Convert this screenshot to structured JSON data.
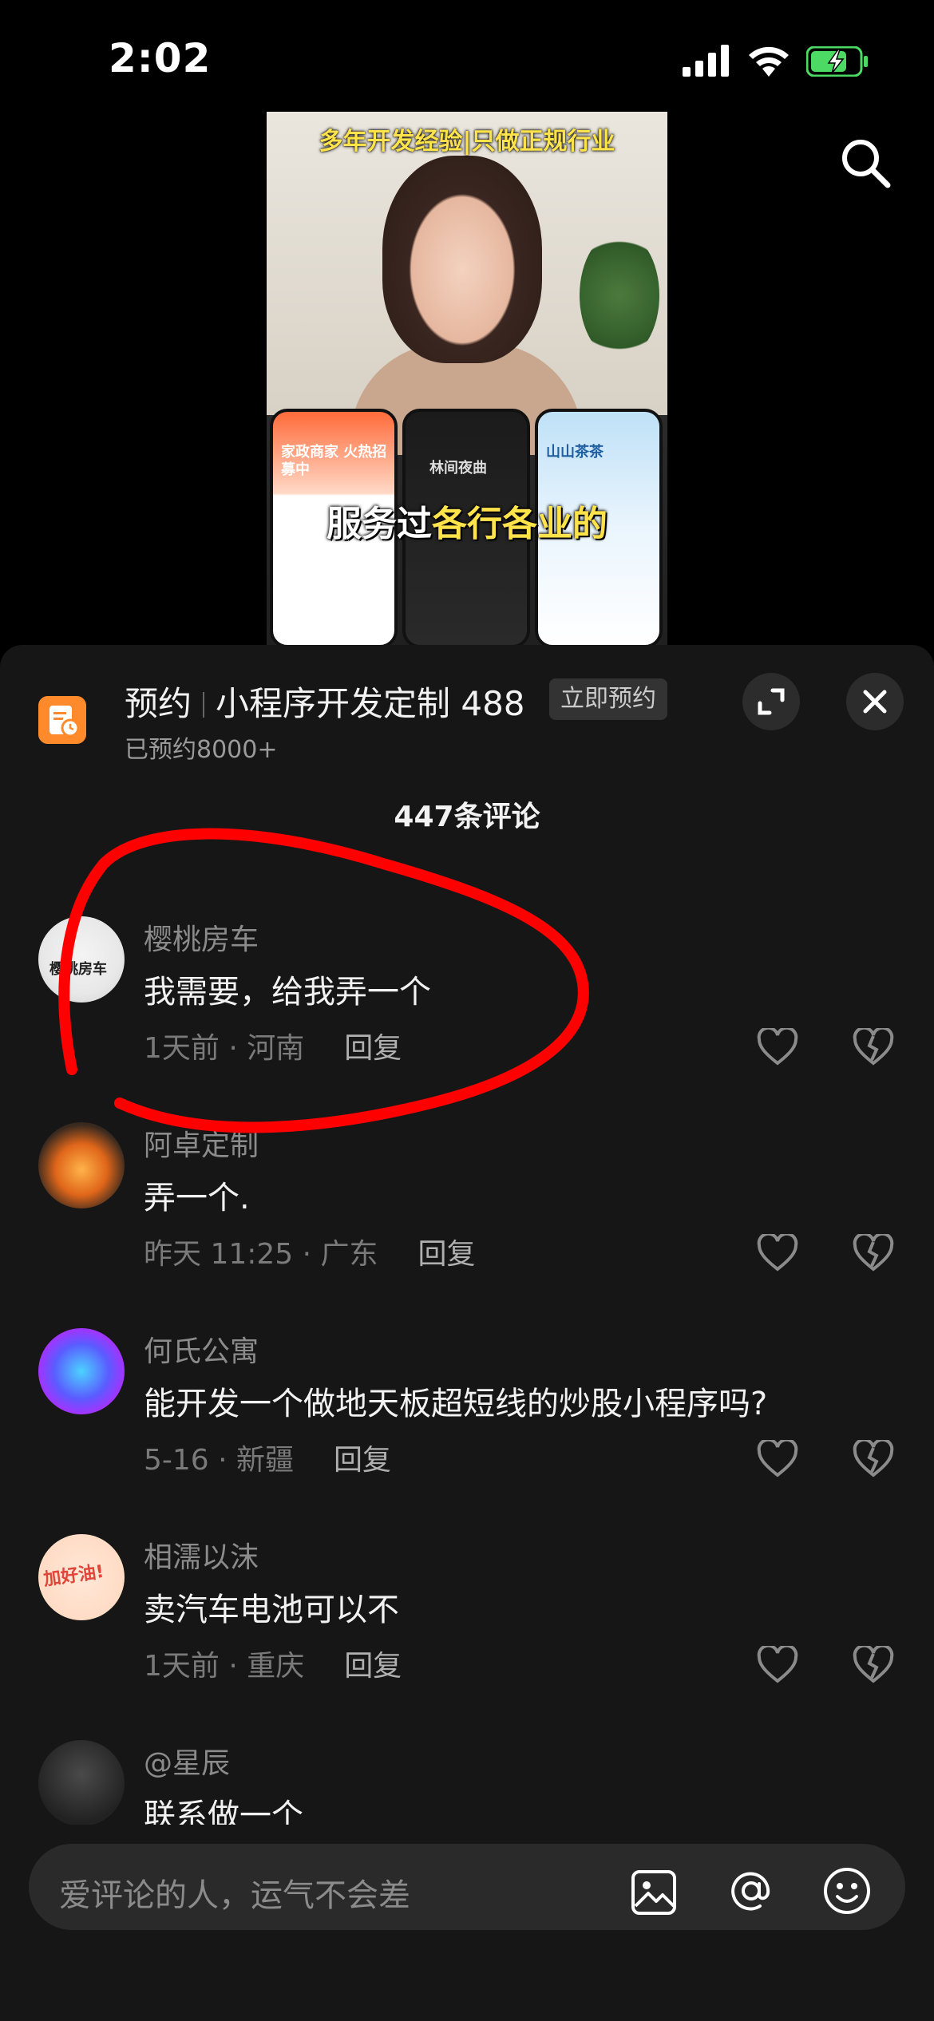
{
  "status_bar": {
    "time": "2:02"
  },
  "video": {
    "caption_top_part1": "多年开发经验",
    "caption_top_part2": "只做正规行业",
    "caption_mid_part1": "服务过",
    "caption_mid_part2": "各行各业的",
    "phone1_text": "家政商家 火热招募中",
    "phone2_text": "林间夜曲",
    "phone3_text": "山山茶茶"
  },
  "promo": {
    "category": "预约",
    "title": "小程序开发定制 488",
    "badge": "立即预约",
    "subtitle": "已预约8000+"
  },
  "comments_count": "447条评论",
  "comments": [
    {
      "user": "樱桃房车",
      "avatar_text": "樱桃房车",
      "text": "我需要，给我弄一个",
      "meta": "1天前 · 河南",
      "reply": "回复"
    },
    {
      "user": "阿卓定制",
      "text": "弄一个.",
      "meta": "昨天 11:25 · 广东",
      "reply": "回复"
    },
    {
      "user": "何氏公寓",
      "text": "能开发一个做地天板超短线的炒股小程序吗?",
      "meta": "5-16 · 新疆",
      "reply": "回复"
    },
    {
      "user": "相濡以沫",
      "avatar_text": "加好油!",
      "text": "卖汽车电池可以不",
      "meta": "1天前 · 重庆",
      "reply": "回复"
    },
    {
      "user": "@星辰",
      "text": "联系做一个",
      "meta": "",
      "reply": ""
    }
  ],
  "input": {
    "placeholder": "爱评论的人，运气不会差"
  },
  "colors": {
    "sheet_bg": "#161616",
    "annotation": "#ff0000",
    "battery_green": "#4cd964",
    "promo_orange": "#ff8a2b"
  }
}
